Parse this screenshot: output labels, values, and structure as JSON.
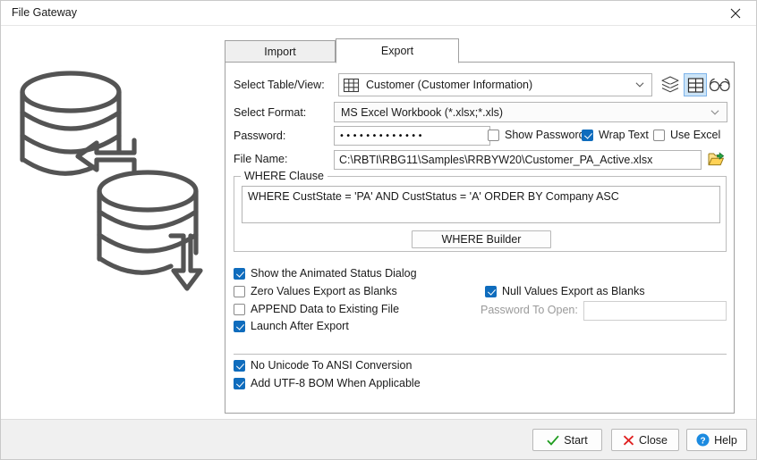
{
  "window": {
    "title": "File Gateway",
    "close_label": "✕"
  },
  "illustration": {
    "name": "database-transfer-illustration"
  },
  "tabs": [
    {
      "label": "Import",
      "active": false
    },
    {
      "label": "Export",
      "active": true
    }
  ],
  "form": {
    "table_view": {
      "label": "Select Table/View:",
      "value": "Customer  (Customer Information)",
      "icons": [
        {
          "name": "layers-stack-icon",
          "selected": false
        },
        {
          "name": "table-grid-icon",
          "selected": true
        },
        {
          "name": "glasses-preview-icon",
          "selected": false
        }
      ]
    },
    "format": {
      "label": "Select Format:",
      "value": "MS Excel Workbook (*.xlsx;*.xls)"
    },
    "password": {
      "label": "Password:",
      "value": "•••••••••••••"
    },
    "show_password": {
      "label": "Show Password",
      "checked": false
    },
    "wrap_text": {
      "label": "Wrap Text",
      "checked": true
    },
    "use_excel": {
      "label": "Use Excel",
      "checked": false
    },
    "file_name": {
      "label": "File Name:",
      "value": "C:\\RBTI\\RBG11\\Samples\\RRBYW20\\Customer_PA_Active.xlsx",
      "browse_icon": "open-folder-icon"
    }
  },
  "where_clause": {
    "group_title": "WHERE Clause",
    "text": "WHERE CustState  =  'PA'  AND   CustStatus  =  'A'  ORDER BY Company ASC",
    "builder_button": "WHERE Builder"
  },
  "options": {
    "left": [
      {
        "label": "Show the Animated Status Dialog",
        "checked": true
      },
      {
        "label": "Zero Values Export as Blanks",
        "checked": false
      },
      {
        "label": "APPEND Data to Existing File",
        "checked": false
      },
      {
        "label": "Launch After Export",
        "checked": true
      }
    ],
    "right": {
      "null_values": {
        "label": "Null Values Export as Blanks",
        "checked": true
      },
      "password_to_open": {
        "label": "Password To Open:",
        "value": "",
        "disabled": true
      }
    },
    "bottom": [
      {
        "label": "No Unicode To ANSI Conversion",
        "checked": true
      },
      {
        "label": "Add UTF-8 BOM When Applicable",
        "checked": true
      }
    ]
  },
  "footer": {
    "start": {
      "label": "Start",
      "icon": "check-mark-icon",
      "color": "#1f9c1f"
    },
    "close": {
      "label": "Close",
      "icon": "x-mark-icon",
      "color": "#e02020"
    },
    "help": {
      "label": "Help",
      "icon": "question-circle-icon",
      "color": "#1b8ae0"
    }
  }
}
